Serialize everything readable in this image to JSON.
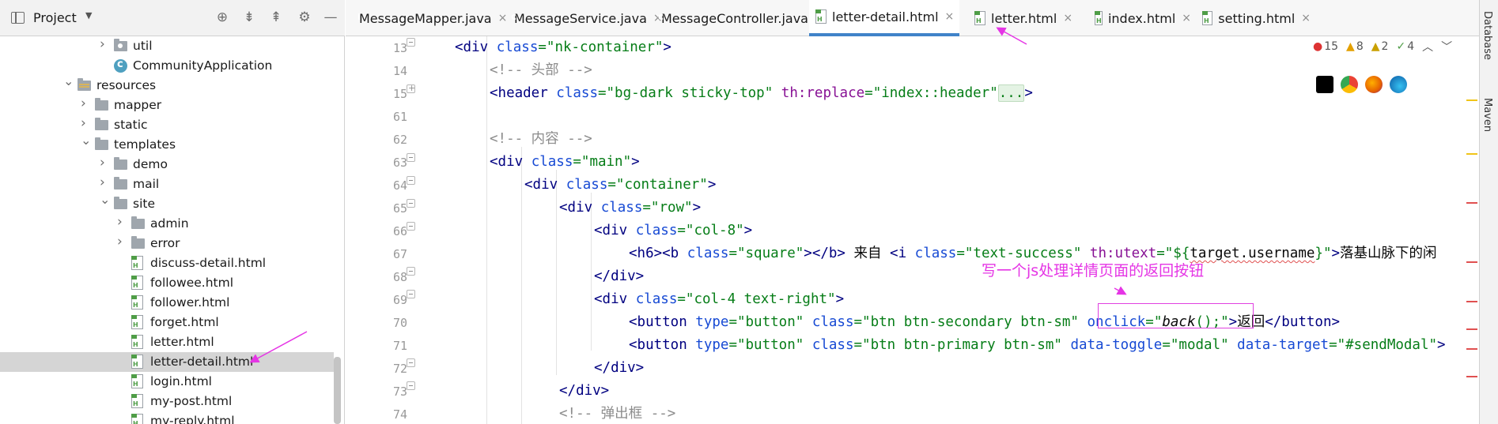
{
  "project_panel": {
    "title": "Project",
    "tree": [
      {
        "label": "util",
        "kind": "pkg",
        "depth": 3,
        "chevron": ">"
      },
      {
        "label": "CommunityApplication",
        "kind": "class",
        "depth": 3,
        "chevron": ""
      },
      {
        "label": "resources",
        "kind": "res",
        "depth": 1,
        "chevron": "v"
      },
      {
        "label": "mapper",
        "kind": "folder",
        "depth": 2,
        "chevron": ">"
      },
      {
        "label": "static",
        "kind": "folder",
        "depth": 2,
        "chevron": ">"
      },
      {
        "label": "templates",
        "kind": "folder",
        "depth": 2,
        "chevron": "v"
      },
      {
        "label": "demo",
        "kind": "folder",
        "depth": 3,
        "chevron": ">"
      },
      {
        "label": "mail",
        "kind": "folder",
        "depth": 3,
        "chevron": ">"
      },
      {
        "label": "site",
        "kind": "folder",
        "depth": 3,
        "chevron": "v"
      },
      {
        "label": "admin",
        "kind": "folder",
        "depth": 4,
        "chevron": ">"
      },
      {
        "label": "error",
        "kind": "folder",
        "depth": 4,
        "chevron": ">"
      },
      {
        "label": "discuss-detail.html",
        "kind": "html",
        "depth": 4,
        "chevron": ""
      },
      {
        "label": "followee.html",
        "kind": "html",
        "depth": 4,
        "chevron": ""
      },
      {
        "label": "follower.html",
        "kind": "html",
        "depth": 4,
        "chevron": ""
      },
      {
        "label": "forget.html",
        "kind": "html",
        "depth": 4,
        "chevron": ""
      },
      {
        "label": "letter.html",
        "kind": "html",
        "depth": 4,
        "chevron": ""
      },
      {
        "label": "letter-detail.html",
        "kind": "html",
        "depth": 4,
        "chevron": "",
        "selected": true
      },
      {
        "label": "login.html",
        "kind": "html",
        "depth": 4,
        "chevron": ""
      },
      {
        "label": "my-post.html",
        "kind": "html",
        "depth": 4,
        "chevron": ""
      },
      {
        "label": "my-reply.html",
        "kind": "html",
        "depth": 4,
        "chevron": ""
      }
    ]
  },
  "tabs": [
    {
      "label": "MessageMapper.java",
      "icon": "interface-icon"
    },
    {
      "label": "MessageService.java",
      "icon": "class-icon"
    },
    {
      "label": "MessageController.java",
      "icon": "class-icon"
    },
    {
      "label": "letter-detail.html",
      "icon": "html-file-icon",
      "active": true
    },
    {
      "label": "letter.html",
      "icon": "html-file-icon"
    },
    {
      "label": "index.html",
      "icon": "html-file-icon"
    },
    {
      "label": "setting.html",
      "icon": "html-file-icon"
    }
  ],
  "inspections": {
    "errors": "15",
    "warnings": "8",
    "weak_warnings": "2",
    "typos": "4"
  },
  "line_numbers": [
    "13",
    "14",
    "15",
    "61",
    "62",
    "63",
    "64",
    "65",
    "66",
    "67",
    "68",
    "69",
    "70",
    "71",
    "72",
    "73",
    "74"
  ],
  "code": {
    "l13": {
      "t1": "<div ",
      "a1": "class",
      "s1": "=\"nk-container\"",
      "t2": ">"
    },
    "l14": {
      "c": "<!-- 头部 -->"
    },
    "l15": {
      "t1": "<header ",
      "a1": "class",
      "s1": "=\"bg-dark sticky-top\"",
      "th": " th:replace",
      "s2": "=\"index::header\"",
      "fold": "...",
      "t2": ">"
    },
    "l62": {
      "c": "<!-- 内容 -->"
    },
    "l63": {
      "t1": "<div ",
      "a1": "class",
      "s1": "=\"main\"",
      "t2": ">"
    },
    "l64": {
      "t1": "<div ",
      "a1": "class",
      "s1": "=\"container\"",
      "t2": ">"
    },
    "l65": {
      "t1": "<div ",
      "a1": "class",
      "s1": "=\"row\"",
      "t2": ">"
    },
    "l66": {
      "t1": "<div ",
      "a1": "class",
      "s1": "=\"col-8\"",
      "t2": ">"
    },
    "l67": {
      "t1": "<h6><b ",
      "a1": "class",
      "s1": "=\"square\"",
      "t2": "></b>",
      "txt": " 来自 ",
      "t3": "<i ",
      "a2": "class",
      "s2": "=\"text-success\"",
      "th": " th:utext",
      "s3a": "=\"${",
      "sq": "target.username",
      "s3b": "}\"",
      "t4": ">",
      "txt2": "落基山脉下的闲"
    },
    "l68": {
      "t1": "</div>"
    },
    "l69": {
      "t1": "<div ",
      "a1": "class",
      "s1": "=\"col-4 text-right\"",
      "t2": ">"
    },
    "l70": {
      "t1": "<button ",
      "a1": "type",
      "s1": "=\"button\"",
      "a2": " class",
      "s2": "=\"btn btn-secondary btn-sm\"",
      "a3": " onclick",
      "s3a": "=\"",
      "fn": "back",
      "s3b": "();\"",
      "t2": ">",
      "txt": "返回",
      "t3": "</button>"
    },
    "l71": {
      "t1": "<button ",
      "a1": "type",
      "s1": "=\"button\"",
      "a2": " class",
      "s2": "=\"btn btn-primary btn-sm\"",
      "a3": " data-toggle",
      "s3": "=\"modal\"",
      "a4": " data-target",
      "s4": "=\"#sendModal\"",
      "t2": ">"
    },
    "l72": {
      "t1": "</div>"
    },
    "l73": {
      "t1": "</div>"
    },
    "l74": {
      "c": "<!-- 弹出框 -->"
    }
  },
  "annotation": "写一个js处理详情页面的返回按钮",
  "right_strip": {
    "database": "Database",
    "maven": "Maven"
  },
  "colors": {
    "annotation": "#e535e5",
    "active_tab": "#4083c9",
    "selection": "#d5d5d5"
  }
}
